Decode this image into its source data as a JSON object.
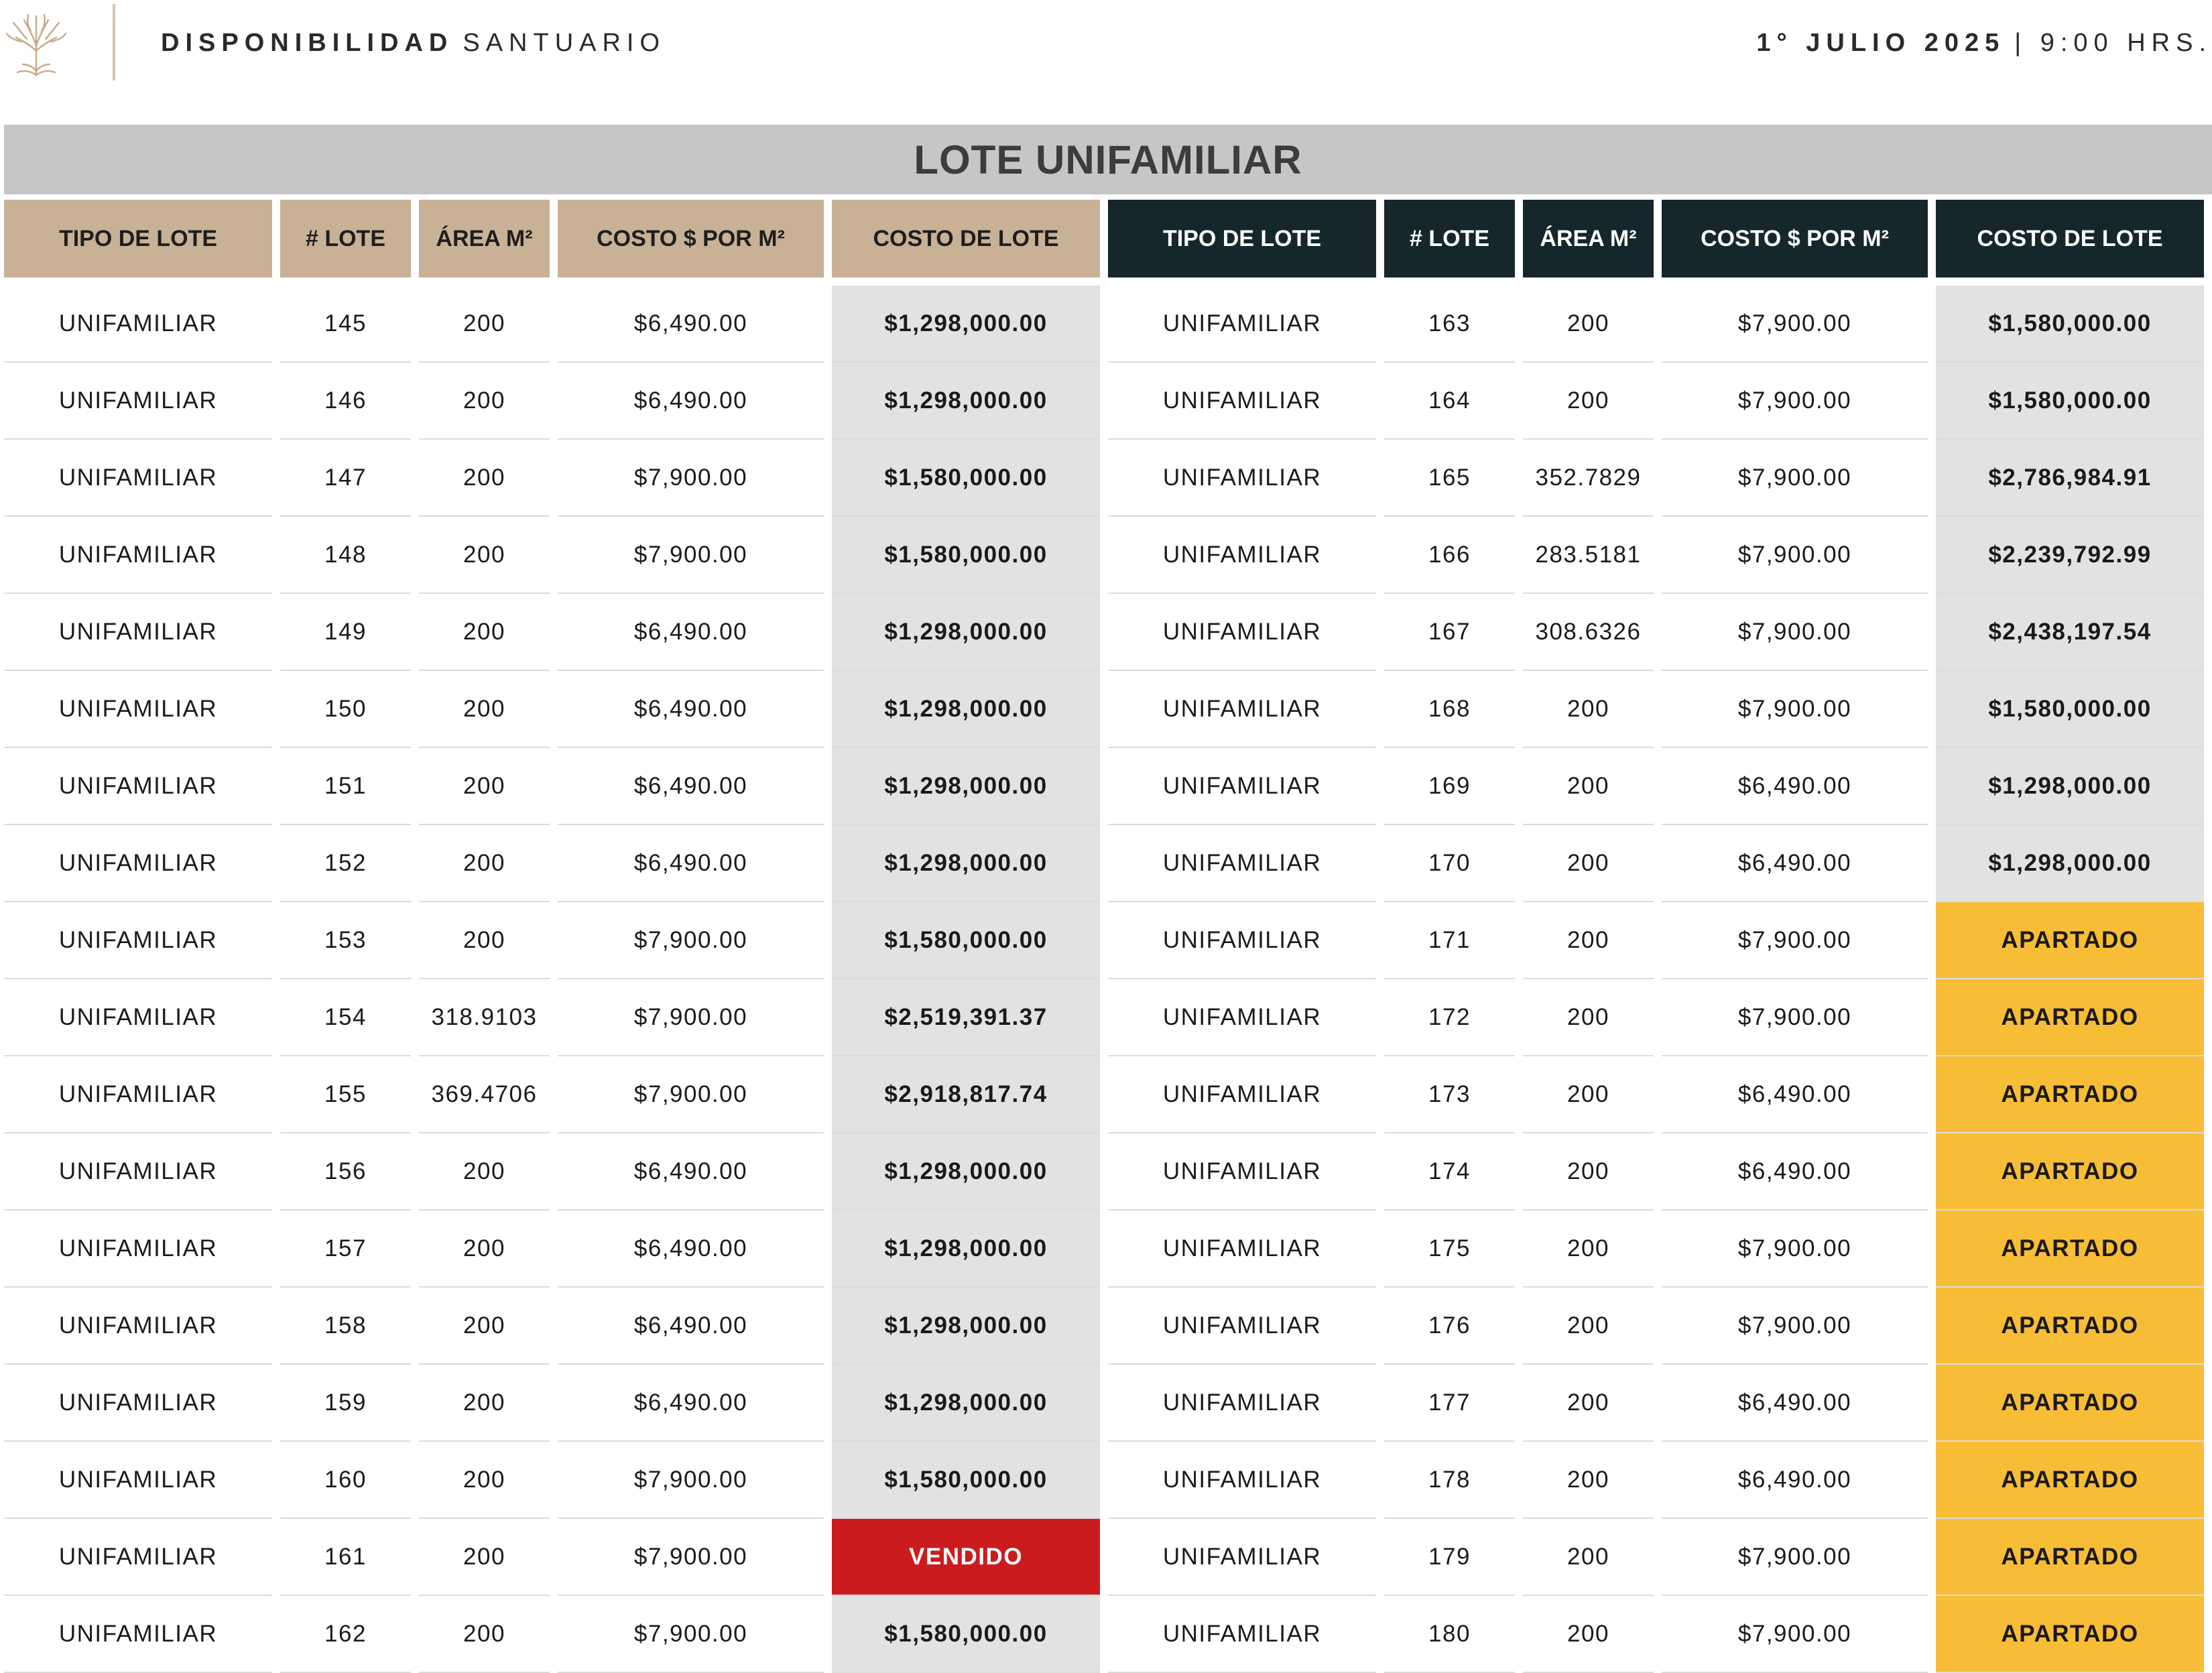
{
  "header": {
    "title_bold": "DISPONIBILIDAD",
    "title_regular": "SANTUARIO",
    "date_bold": "1° JULIO 2025",
    "date_regular": "| 9:00 HRS.",
    "logo_icon": "tree-icon",
    "accent_color": "#c9b196"
  },
  "banner": {
    "title": "LOTE UNIFAMILIAR"
  },
  "table": {
    "headers": [
      "TIPO DE LOTE",
      "# LOTE",
      "ÁREA M²",
      "COSTO $ POR M²",
      "COSTO DE LOTE",
      "TIPO DE LOTE",
      "# LOTE",
      "ÁREA M²",
      "COSTO $ POR M²",
      "COSTO DE LOTE"
    ],
    "colors": {
      "left_header": "#c9b196",
      "right_header": "#15272d",
      "cost_cell": "#e2e2e2",
      "apartado": "#f8bd36",
      "vendido": "#cc1b1e"
    },
    "rows": [
      [
        "UNIFAMILIAR",
        "145",
        "200",
        "$6,490.00",
        "$1,298,000.00",
        "UNIFAMILIAR",
        "163",
        "200",
        "$7,900.00",
        "$1,580,000.00"
      ],
      [
        "UNIFAMILIAR",
        "146",
        "200",
        "$6,490.00",
        "$1,298,000.00",
        "UNIFAMILIAR",
        "164",
        "200",
        "$7,900.00",
        "$1,580,000.00"
      ],
      [
        "UNIFAMILIAR",
        "147",
        "200",
        "$7,900.00",
        "$1,580,000.00",
        "UNIFAMILIAR",
        "165",
        "352.7829",
        "$7,900.00",
        "$2,786,984.91"
      ],
      [
        "UNIFAMILIAR",
        "148",
        "200",
        "$7,900.00",
        "$1,580,000.00",
        "UNIFAMILIAR",
        "166",
        "283.5181",
        "$7,900.00",
        "$2,239,792.99"
      ],
      [
        "UNIFAMILIAR",
        "149",
        "200",
        "$6,490.00",
        "$1,298,000.00",
        "UNIFAMILIAR",
        "167",
        "308.6326",
        "$7,900.00",
        "$2,438,197.54"
      ],
      [
        "UNIFAMILIAR",
        "150",
        "200",
        "$6,490.00",
        "$1,298,000.00",
        "UNIFAMILIAR",
        "168",
        "200",
        "$7,900.00",
        "$1,580,000.00"
      ],
      [
        "UNIFAMILIAR",
        "151",
        "200",
        "$6,490.00",
        "$1,298,000.00",
        "UNIFAMILIAR",
        "169",
        "200",
        "$6,490.00",
        "$1,298,000.00"
      ],
      [
        "UNIFAMILIAR",
        "152",
        "200",
        "$6,490.00",
        "$1,298,000.00",
        "UNIFAMILIAR",
        "170",
        "200",
        "$6,490.00",
        "$1,298,000.00"
      ],
      [
        "UNIFAMILIAR",
        "153",
        "200",
        "$7,900.00",
        "$1,580,000.00",
        "UNIFAMILIAR",
        "171",
        "200",
        "$7,900.00",
        "APARTADO"
      ],
      [
        "UNIFAMILIAR",
        "154",
        "318.9103",
        "$7,900.00",
        "$2,519,391.37",
        "UNIFAMILIAR",
        "172",
        "200",
        "$7,900.00",
        "APARTADO"
      ],
      [
        "UNIFAMILIAR",
        "155",
        "369.4706",
        "$7,900.00",
        "$2,918,817.74",
        "UNIFAMILIAR",
        "173",
        "200",
        "$6,490.00",
        "APARTADO"
      ],
      [
        "UNIFAMILIAR",
        "156",
        "200",
        "$6,490.00",
        "$1,298,000.00",
        "UNIFAMILIAR",
        "174",
        "200",
        "$6,490.00",
        "APARTADO"
      ],
      [
        "UNIFAMILIAR",
        "157",
        "200",
        "$6,490.00",
        "$1,298,000.00",
        "UNIFAMILIAR",
        "175",
        "200",
        "$7,900.00",
        "APARTADO"
      ],
      [
        "UNIFAMILIAR",
        "158",
        "200",
        "$6,490.00",
        "$1,298,000.00",
        "UNIFAMILIAR",
        "176",
        "200",
        "$7,900.00",
        "APARTADO"
      ],
      [
        "UNIFAMILIAR",
        "159",
        "200",
        "$6,490.00",
        "$1,298,000.00",
        "UNIFAMILIAR",
        "177",
        "200",
        "$6,490.00",
        "APARTADO"
      ],
      [
        "UNIFAMILIAR",
        "160",
        "200",
        "$7,900.00",
        "$1,580,000.00",
        "UNIFAMILIAR",
        "178",
        "200",
        "$6,490.00",
        "APARTADO"
      ],
      [
        "UNIFAMILIAR",
        "161",
        "200",
        "$7,900.00",
        "VENDIDO",
        "UNIFAMILIAR",
        "179",
        "200",
        "$7,900.00",
        "APARTADO"
      ],
      [
        "UNIFAMILIAR",
        "162",
        "200",
        "$7,900.00",
        "$1,580,000.00",
        "UNIFAMILIAR",
        "180",
        "200",
        "$7,900.00",
        "APARTADO"
      ]
    ]
  }
}
